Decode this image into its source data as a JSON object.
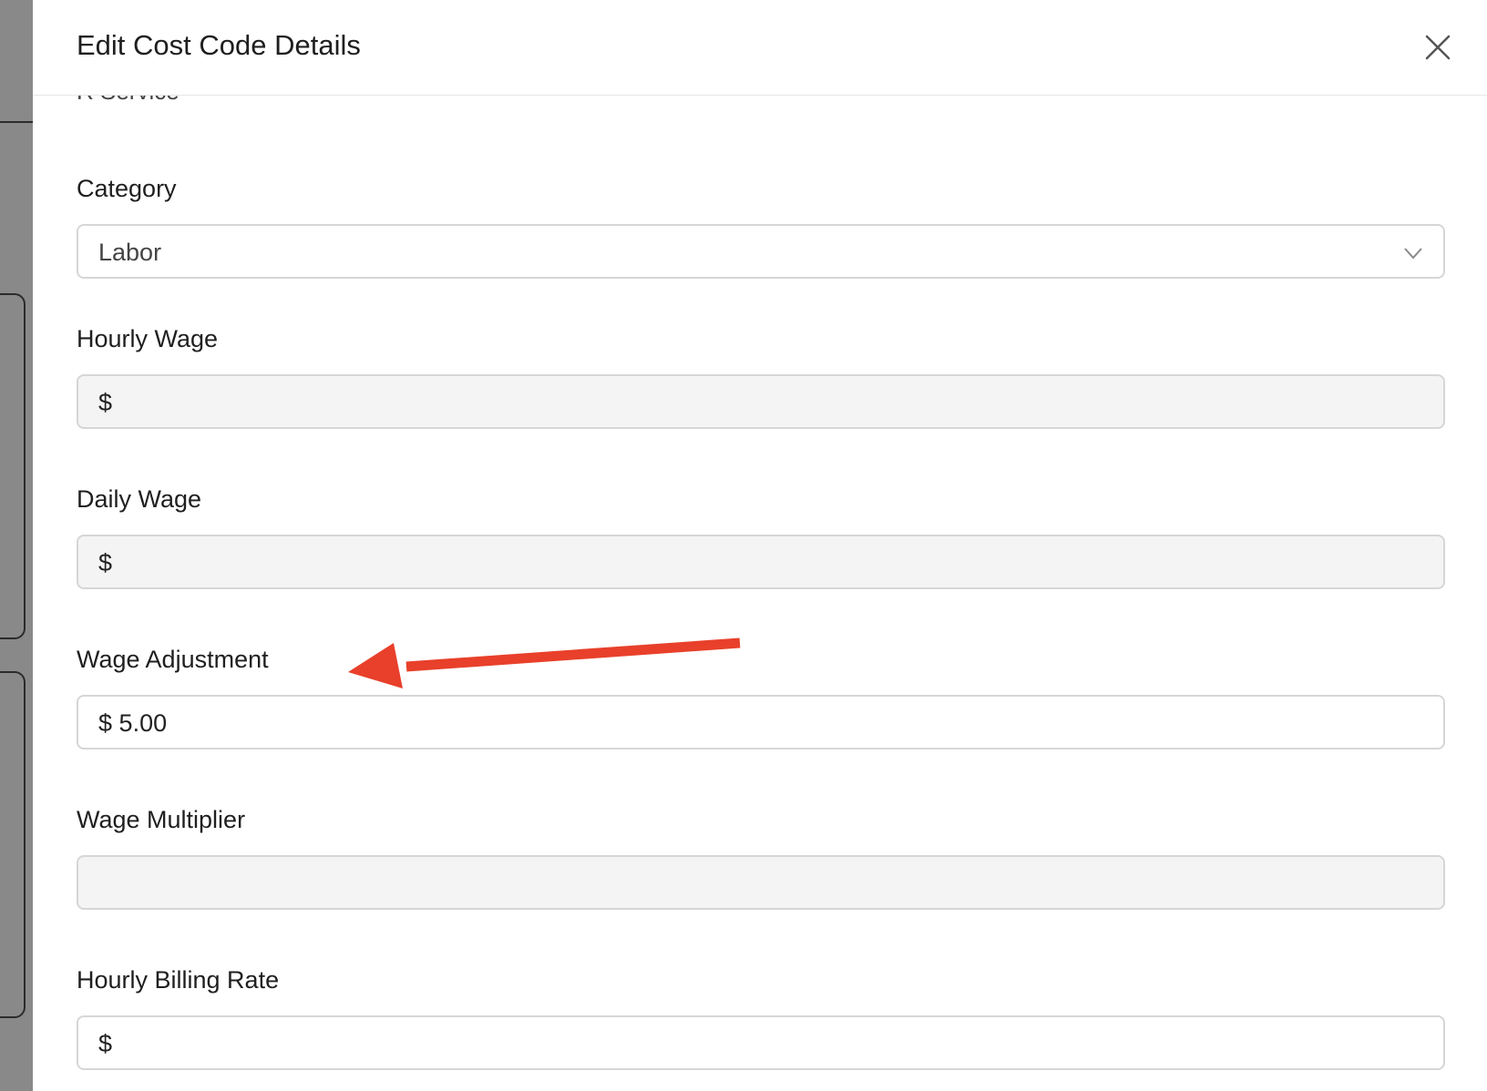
{
  "dialog": {
    "title": "Edit Cost Code Details",
    "cutoff_text": "R Service"
  },
  "fields": {
    "category": {
      "label": "Category",
      "value": "Labor"
    },
    "hourly_wage": {
      "label": "Hourly Wage",
      "prefix": "$",
      "value": ""
    },
    "daily_wage": {
      "label": "Daily Wage",
      "prefix": "$",
      "value": ""
    },
    "wage_adjustment": {
      "label": "Wage Adjustment",
      "prefix": "$",
      "value": "5.00"
    },
    "wage_multiplier": {
      "label": "Wage Multiplier",
      "value": ""
    },
    "hourly_billing_rate": {
      "label": "Hourly Billing Rate",
      "prefix": "$",
      "value": ""
    }
  },
  "annotation": {
    "arrow_color": "#e8402a"
  },
  "icons": {
    "close": "close-icon",
    "dropdown": "chevron-down-icon"
  }
}
